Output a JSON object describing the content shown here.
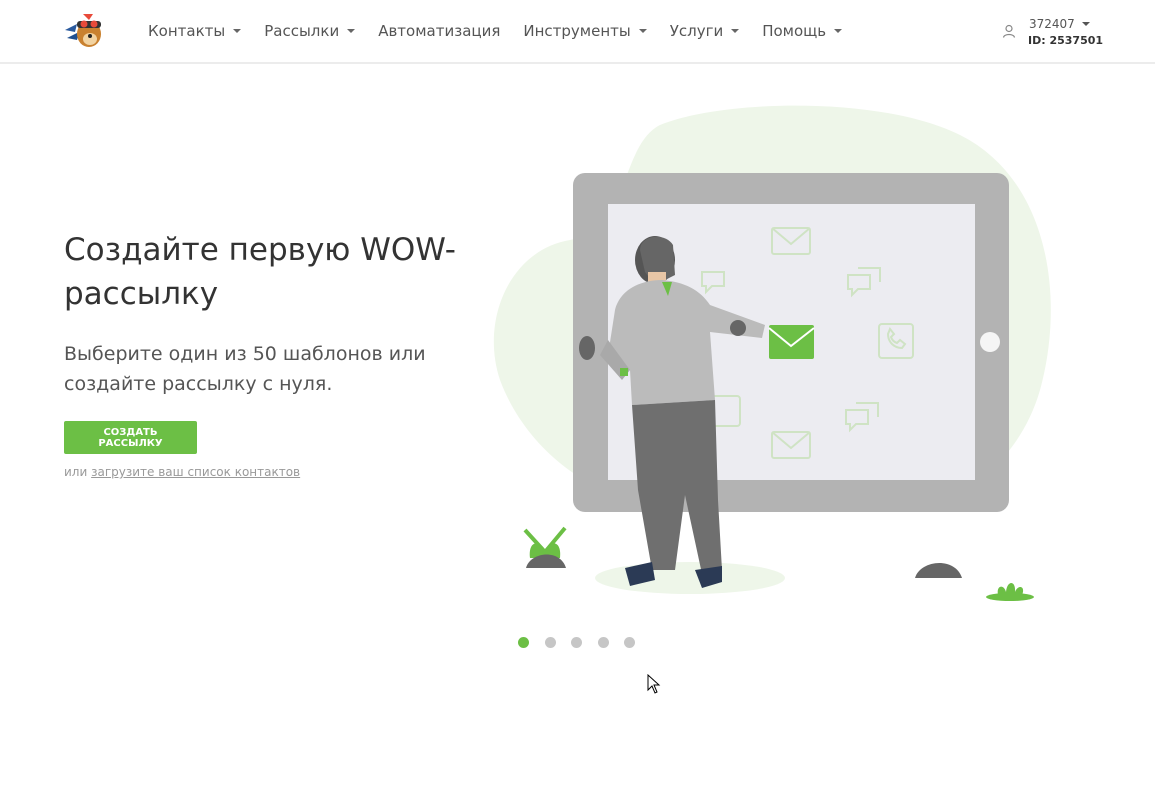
{
  "header": {
    "nav": [
      {
        "label": "Контакты",
        "dropdown": true
      },
      {
        "label": "Рассылки",
        "dropdown": true
      },
      {
        "label": "Автоматизация",
        "dropdown": false
      },
      {
        "label": "Инструменты",
        "dropdown": true
      },
      {
        "label": "Услуги",
        "dropdown": true
      },
      {
        "label": "Помощь",
        "dropdown": true
      }
    ],
    "user": {
      "name": "372407",
      "id": "ID: 2537501",
      "icon": "user-icon"
    }
  },
  "hero": {
    "title": "Создайте первую WOW-рассылку",
    "subtitle": "Выберите один из 50 шаблонов или создайте рассылку с нуля.",
    "cta_label": "Создать рассылку",
    "alt_prefix": "или",
    "alt_link": "загрузите ваш список контактов"
  },
  "carousel": {
    "count": 5,
    "active_index": 0
  },
  "colors": {
    "accent": "#6cbf45",
    "dot_inactive": "#c6c6c6",
    "tablet": "#b3b3b3",
    "screen": "#ececf1",
    "blob": "#eef6e9"
  }
}
